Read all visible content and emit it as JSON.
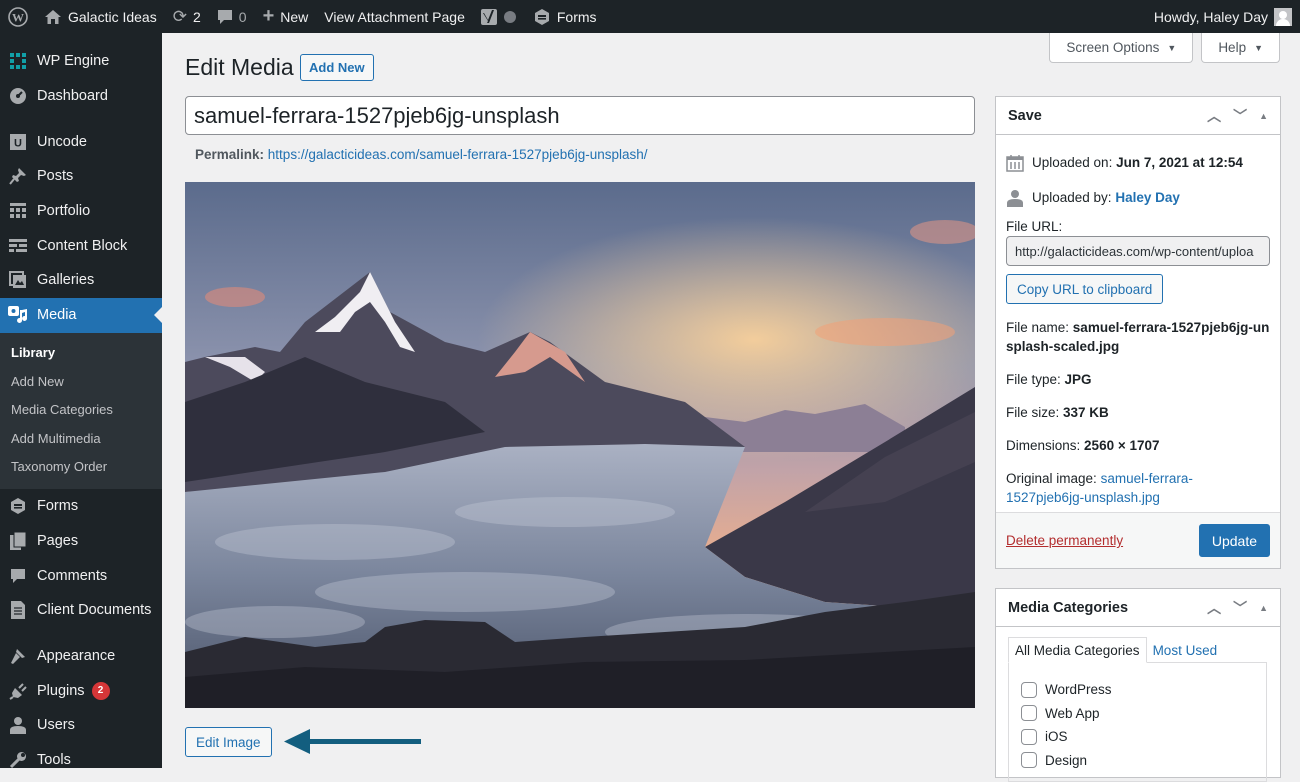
{
  "adminbar": {
    "site_name": "Galactic Ideas",
    "updates_count": "2",
    "comments_count": "0",
    "new_label": "New",
    "view_attachment_label": "View Attachment Page",
    "forms_label": "Forms",
    "howdy": "Howdy, Haley Day"
  },
  "sidebar": {
    "items_top": [
      {
        "label": "WP Engine",
        "icon": "wp-engine-icon"
      },
      {
        "label": "Dashboard",
        "icon": "dashboard-icon"
      }
    ],
    "items_mid": [
      {
        "label": "Uncode",
        "icon": "uncode-icon"
      },
      {
        "label": "Posts",
        "icon": "pushpin-icon"
      },
      {
        "label": "Portfolio",
        "icon": "portfolio-icon"
      },
      {
        "label": "Content Block",
        "icon": "content-block-icon"
      },
      {
        "label": "Galleries",
        "icon": "galleries-icon"
      },
      {
        "label": "Media",
        "icon": "media-icon",
        "active": true
      }
    ],
    "media_submenu": [
      "Library",
      "Add New",
      "Media Categories",
      "Add Multimedia",
      "Taxonomy Order"
    ],
    "items_after": [
      {
        "label": "Forms",
        "icon": "forms-icon"
      },
      {
        "label": "Pages",
        "icon": "pages-icon"
      },
      {
        "label": "Comments",
        "icon": "comments-icon"
      },
      {
        "label": "Client Documents",
        "icon": "document-icon"
      }
    ],
    "items_bottom": [
      {
        "label": "Appearance",
        "icon": "paintbrush-icon"
      },
      {
        "label": "Plugins",
        "icon": "plugin-icon",
        "badge": "2"
      },
      {
        "label": "Users",
        "icon": "users-icon"
      },
      {
        "label": "Tools",
        "icon": "wrench-icon"
      }
    ]
  },
  "screen_meta": {
    "screen_options": "Screen Options",
    "help": "Help"
  },
  "main": {
    "page_title": "Edit Media",
    "add_new_label": "Add New",
    "title_value": "samuel-ferrara-1527pjeb6jg-unsplash",
    "permalink_label": "Permalink:",
    "permalink_url": "https://galacticideas.com/samuel-ferrara-1527pjeb6jg-unsplash/",
    "image_alt": "Mountain peaks above a sea of clouds at sunset",
    "edit_image_label": "Edit Image"
  },
  "save_box": {
    "title": "Save",
    "uploaded_on_label": "Uploaded on:",
    "uploaded_on_value": "Jun 7, 2021 at 12:54",
    "uploaded_by_label": "Uploaded by:",
    "uploaded_by_value": "Haley Day",
    "file_url_label": "File URL:",
    "file_url_value": "http://galacticideas.com/wp-content/uploa",
    "copy_url_label": "Copy URL to clipboard",
    "file_name_label": "File name:",
    "file_name_value": "samuel-ferrara-1527pjeb6jg-unsplash-scaled.jpg",
    "file_type_label": "File type:",
    "file_type_value": "JPG",
    "file_size_label": "File size:",
    "file_size_value": "337 KB",
    "dimensions_label": "Dimensions:",
    "dimensions_value": "2560 × 1707",
    "original_image_label": "Original image:",
    "original_image_value": "samuel-ferrara-1527pjeb6jg-unsplash.jpg",
    "delete_label": "Delete permanently",
    "update_label": "Update"
  },
  "categories_box": {
    "title": "Media Categories",
    "tabs": [
      "All Media Categories",
      "Most Used"
    ],
    "categories": [
      {
        "label": "WordPress",
        "checked": false
      },
      {
        "label": "Web App",
        "checked": false
      },
      {
        "label": "iOS",
        "checked": false
      },
      {
        "label": "Design",
        "checked": false
      }
    ]
  },
  "colors": {
    "accent": "#2271b1",
    "adminbar": "#1d2327",
    "danger": "#b32d2e",
    "arrow": "#135e7f"
  }
}
